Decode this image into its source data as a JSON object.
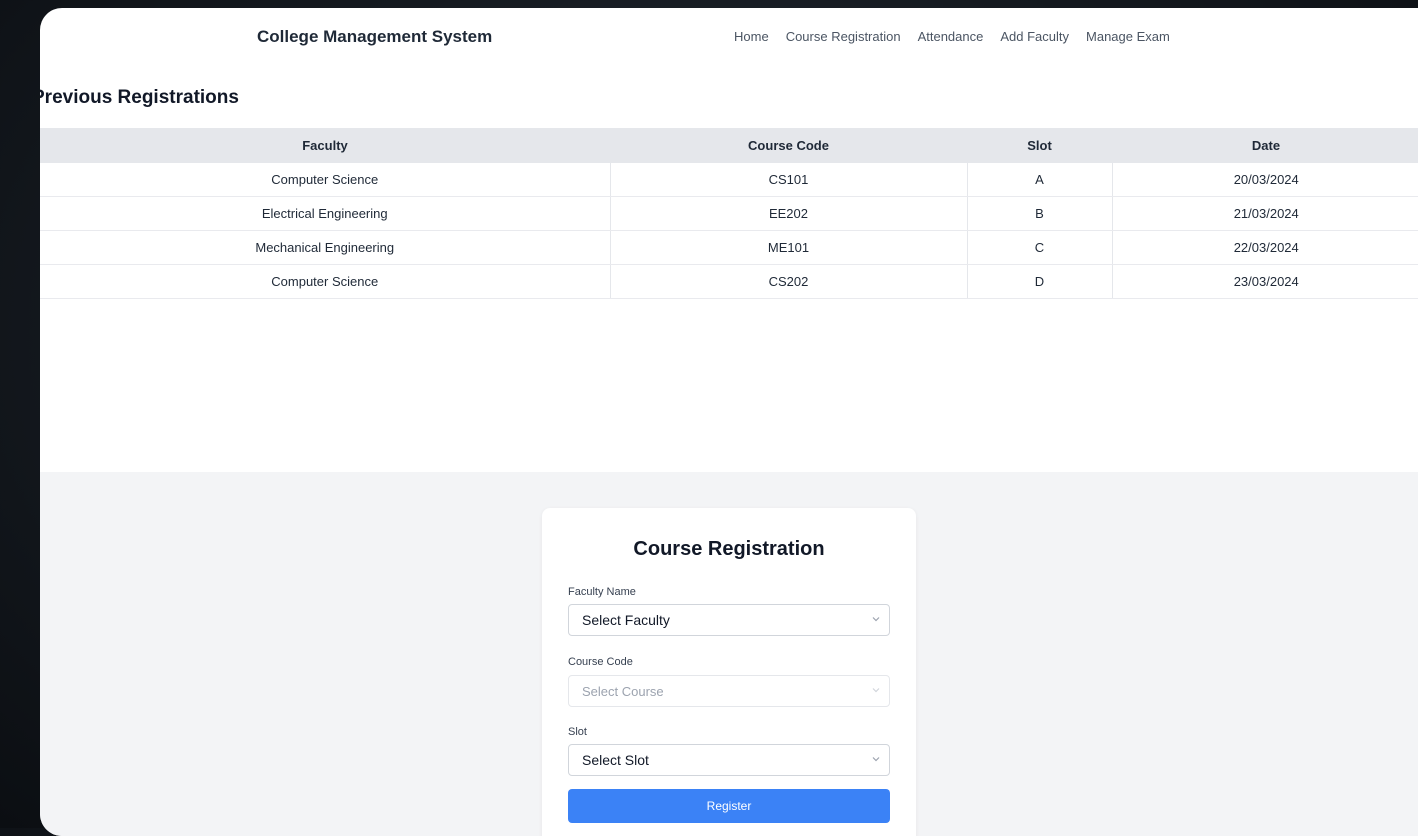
{
  "app": {
    "brand": "College Management System"
  },
  "nav": {
    "links": [
      "Home",
      "Course Registration",
      "Attendance",
      "Add Faculty",
      "Manage Exam"
    ]
  },
  "previous_registrations": {
    "title": "Previous Registrations",
    "headers": [
      "Faculty",
      "Course Code",
      "Slot",
      "Date"
    ],
    "rows": [
      [
        "Computer Science",
        "CS101",
        "A",
        "20/03/2024"
      ],
      [
        "Electrical Engineering",
        "EE202",
        "B",
        "21/03/2024"
      ],
      [
        "Mechanical Engineering",
        "ME101",
        "C",
        "22/03/2024"
      ],
      [
        "Computer Science",
        "CS202",
        "D",
        "23/03/2024"
      ]
    ]
  },
  "form": {
    "title": "Course Registration",
    "faculty_label": "Faculty Name",
    "faculty_value": "Select Faculty",
    "course_label": "Course Code",
    "course_value": "Select Course",
    "slot_label": "Slot",
    "slot_value": "Select Slot",
    "submit_label": "Register"
  },
  "colors": {
    "accent": "#3b82f6",
    "table_header_bg": "#e5e7eb",
    "lower_bg": "#f3f4f6"
  },
  "icons": {
    "select_arrow": "chevron-down-icon"
  }
}
